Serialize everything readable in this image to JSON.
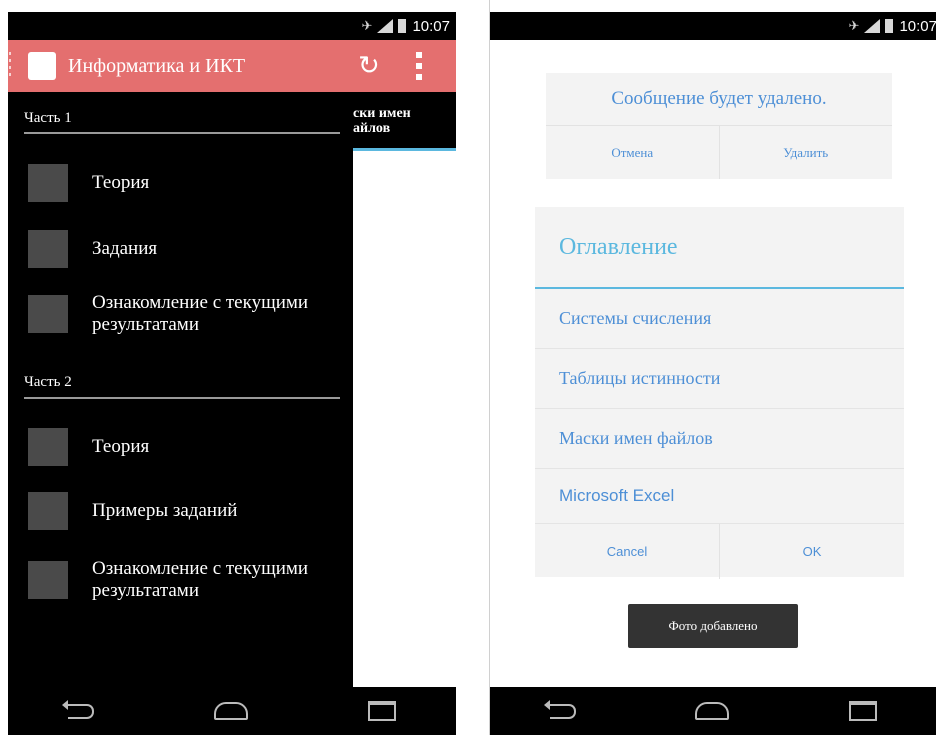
{
  "status_bar": {
    "time": "10:07"
  },
  "left_screen": {
    "app_title": "Информатика и ИКТ",
    "behind_tab_label": "ски имен\nайлов",
    "sections": [
      {
        "label": "Часть 1",
        "items": [
          {
            "label": "Теория"
          },
          {
            "label": "Задания"
          },
          {
            "label": "Ознакомление с текущими результатами"
          }
        ]
      },
      {
        "label": "Часть 2",
        "items": [
          {
            "label": "Теория"
          },
          {
            "label": "Примеры заданий"
          },
          {
            "label": "Ознакомление с текущими результатами"
          }
        ]
      }
    ]
  },
  "right_screen": {
    "confirm_dialog": {
      "message": "Сообщение будет удалено.",
      "cancel_label": "Отмена",
      "delete_label": "Удалить"
    },
    "toc_dialog": {
      "title": "Оглавление",
      "items": [
        "Системы счисления",
        "Таблицы истинности",
        "Маски имен файлов",
        "Microsoft Excel"
      ],
      "cancel_label": "Cancel",
      "ok_label": "OK"
    },
    "toast": "Фото добавлено"
  },
  "icons": {
    "refresh": "refresh-icon",
    "overflow": "overflow-menu-icon",
    "back": "back-icon",
    "home": "home-icon",
    "recent": "recent-apps-icon"
  },
  "colors": {
    "action_bar": "#e46f6f",
    "accent_blue": "#5bb8df",
    "link_blue": "#4d8fd6"
  }
}
